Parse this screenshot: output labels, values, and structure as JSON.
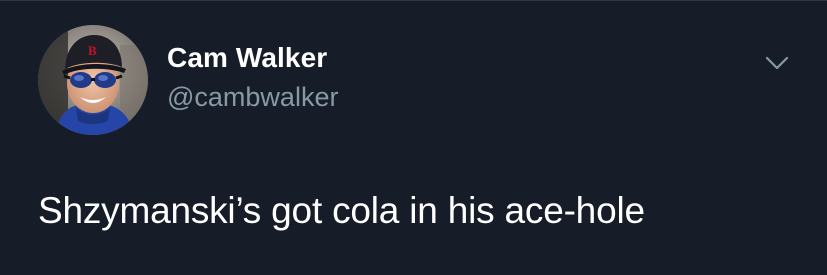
{
  "tweet": {
    "author": {
      "display_name": "Cam Walker",
      "handle": "@cambwalker",
      "avatar_icon": "profile-photo"
    },
    "text": "Shzymanski’s got cola in his ace-hole",
    "menu_icon": "chevron-down-icon"
  },
  "colors": {
    "background": "#161d29",
    "primary_text": "#ffffff",
    "secondary_text": "#8899a6",
    "border": "#2f3640"
  }
}
